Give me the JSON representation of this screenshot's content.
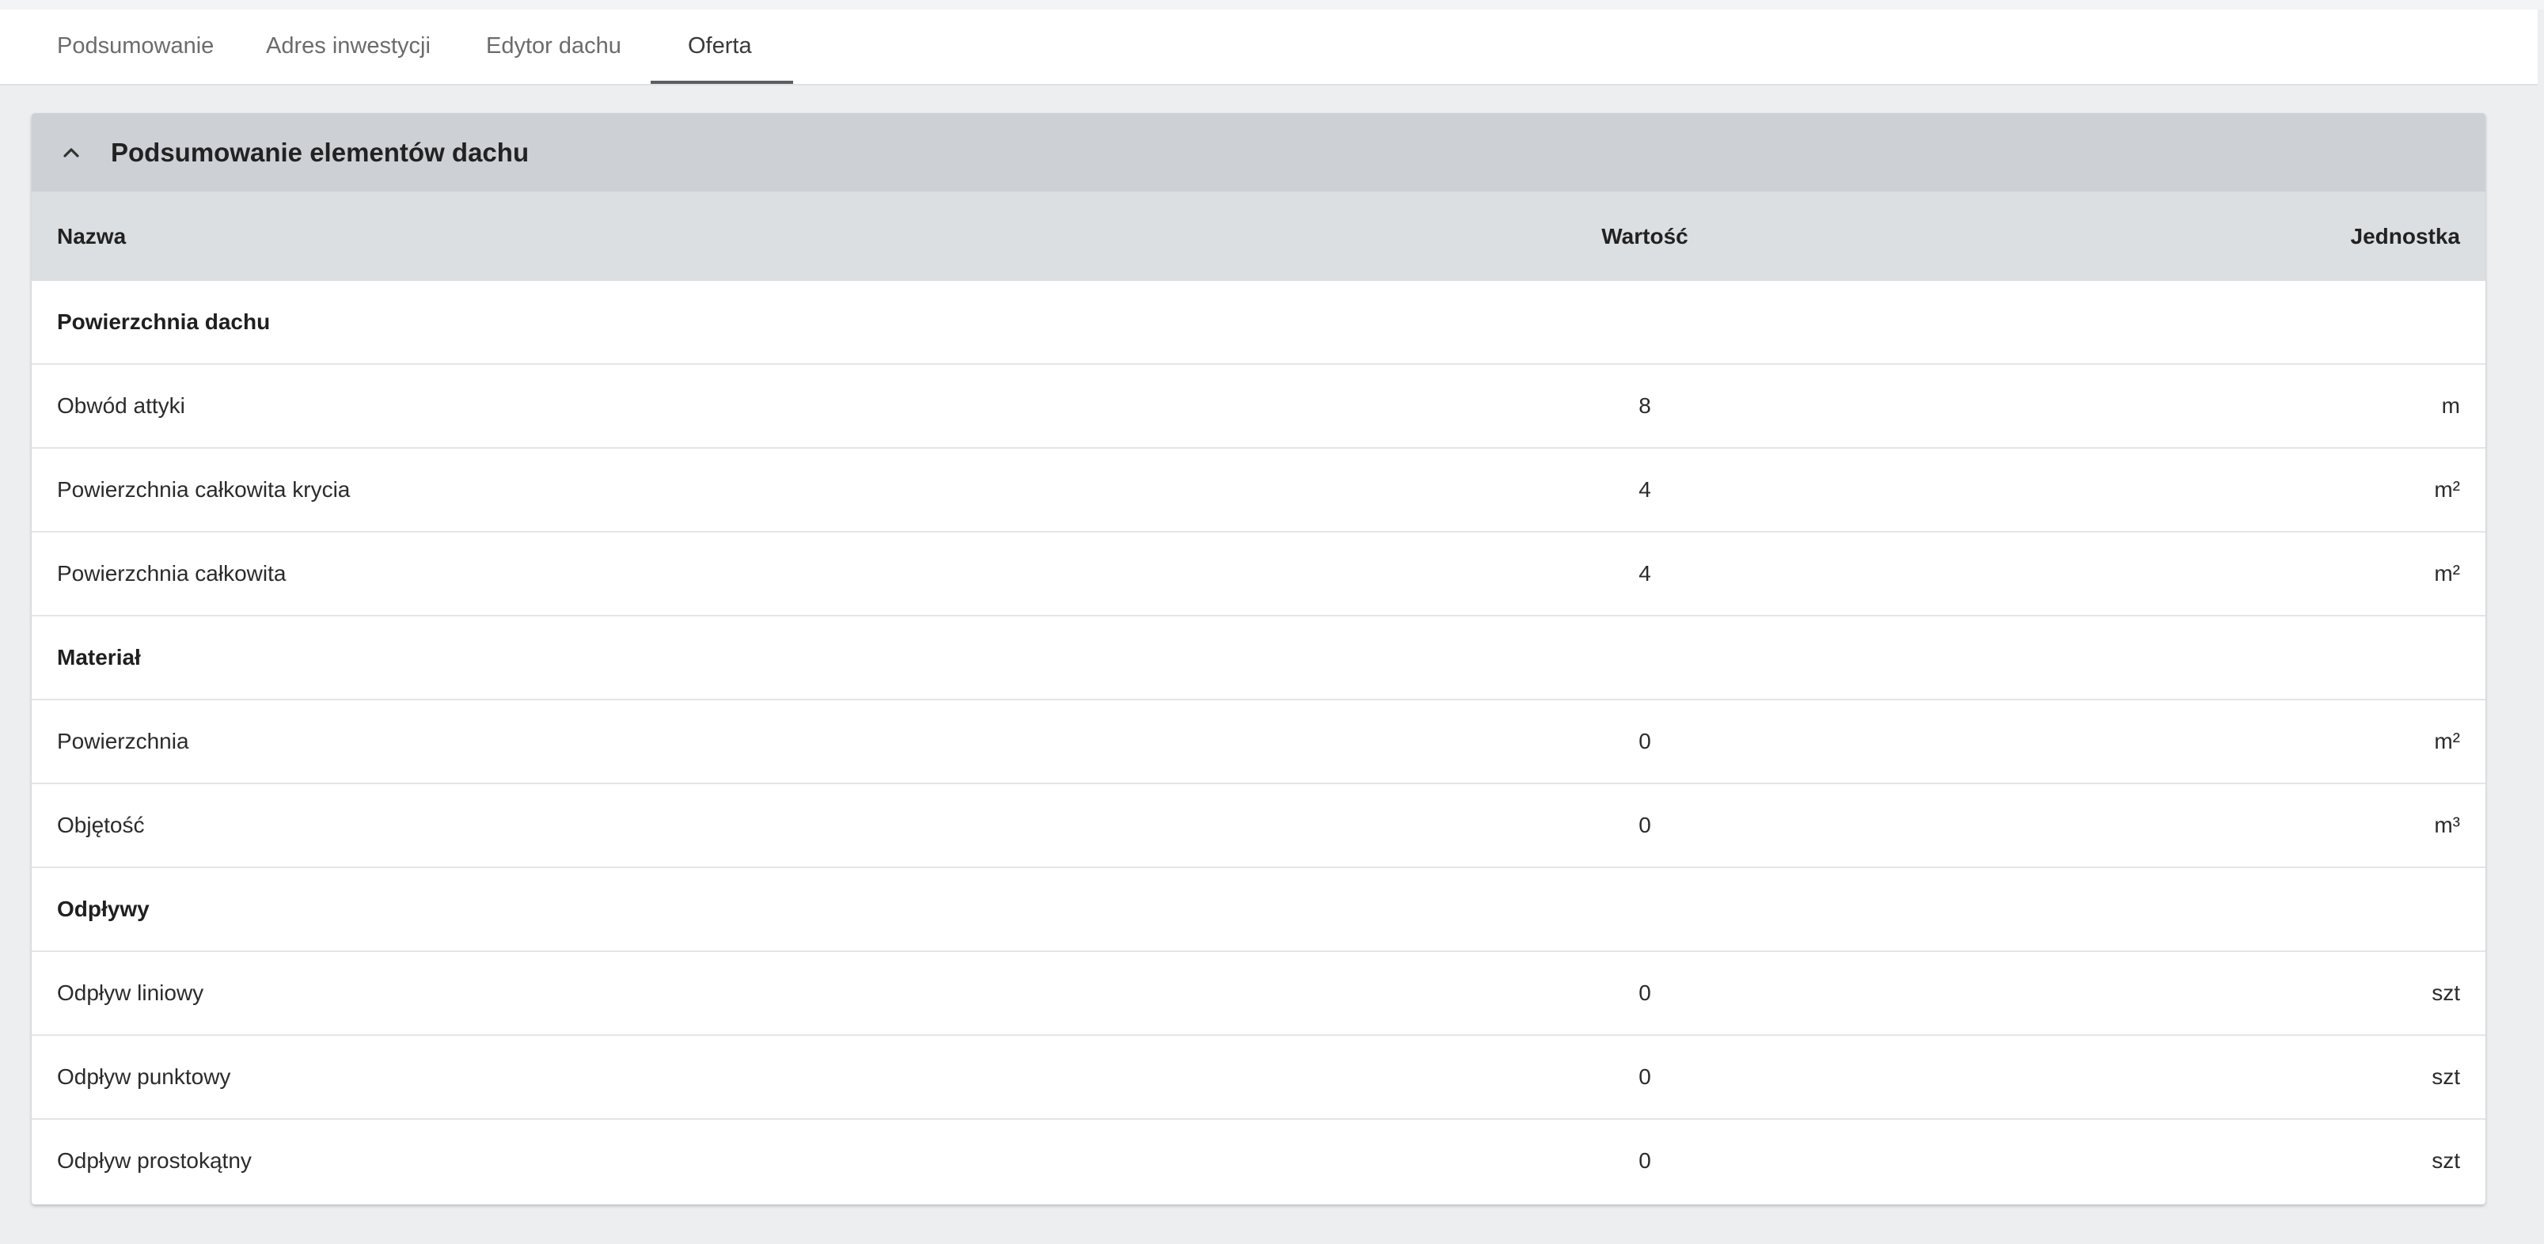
{
  "tabs": [
    {
      "label": "Podsumowanie"
    },
    {
      "label": "Adres inwestycji"
    },
    {
      "label": "Edytor dachu"
    },
    {
      "label": "Oferta"
    }
  ],
  "active_tab": "Oferta",
  "panel": {
    "title": "Podsumowanie elementów dachu",
    "columns": {
      "name": "Nazwa",
      "value": "Wartość",
      "unit": "Jednostka"
    },
    "rows": [
      {
        "name": "Powierzchnia dachu",
        "value": "",
        "unit": ""
      },
      {
        "name": "Obwód attyki",
        "value": "8",
        "unit": "m"
      },
      {
        "name": "Powierzchnia całkowita krycia",
        "value": "4",
        "unit": "m²"
      },
      {
        "name": "Powierzchnia całkowita",
        "value": "4",
        "unit": "m²"
      },
      {
        "name": "Materiał",
        "value": "",
        "unit": ""
      },
      {
        "name": "Powierzchnia",
        "value": "0",
        "unit": "m²"
      },
      {
        "name": "Objętość",
        "value": "0",
        "unit": "m³"
      },
      {
        "name": "Odpływy",
        "value": "",
        "unit": ""
      },
      {
        "name": "Odpływ liniowy",
        "value": "0",
        "unit": "szt"
      },
      {
        "name": "Odpływ punktowy",
        "value": "0",
        "unit": "szt"
      },
      {
        "name": "Odpływ prostokątny",
        "value": "0",
        "unit": "szt"
      }
    ]
  },
  "icons": {
    "collapse": "chevron-up-icon"
  }
}
